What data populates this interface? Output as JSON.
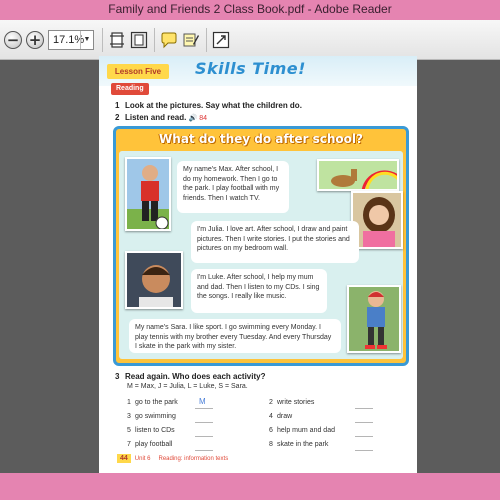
{
  "window": {
    "title": "Family and Friends 2 Class Book.pdf - Adobe Reader"
  },
  "toolbar": {
    "zoom_value": "17.1%",
    "zoom_out": "−",
    "zoom_in": "+",
    "dropdown_arrow": "▼"
  },
  "page": {
    "lesson": "Lesson Five",
    "heading": "Skills Time!",
    "section": "Reading",
    "instructions": [
      {
        "num": "1",
        "text": "Look at the pictures. Say what the children do."
      },
      {
        "num": "2",
        "text": "Listen and read.",
        "audio": "🔊 84"
      }
    ],
    "story": {
      "title": "What do they do after school?",
      "bubbles": [
        "My name's Max. After school, I do my homework. Then I go to the park. I play football with my friends. Then I watch TV.",
        "I'm Julia. I love art. After school, I draw and paint pictures. Then I write stories. I put the stories and pictures on my bedroom wall.",
        "I'm Luke. After school, I help my mum and dad. Then I listen to my CDs. I sing the songs. I really like music.",
        "My name's Sara. I like sport. I go swimming every Monday. I play tennis with my brother every Tuesday. And every Thursday I skate in the park with my sister."
      ]
    },
    "q3": {
      "num": "3",
      "text": "Read again. Who does each activity?",
      "key": "M = Max,  J = Julia,  L = Luke,  S = Sara."
    },
    "activities": [
      {
        "num": "1",
        "text": "go to the park",
        "answer": "M"
      },
      {
        "num": "2",
        "text": "write stories",
        "answer": ""
      },
      {
        "num": "3",
        "text": "go swimming",
        "answer": ""
      },
      {
        "num": "4",
        "text": "draw",
        "answer": ""
      },
      {
        "num": "5",
        "text": "listen to CDs",
        "answer": ""
      },
      {
        "num": "6",
        "text": "help mum and dad",
        "answer": ""
      },
      {
        "num": "7",
        "text": "play football",
        "answer": ""
      },
      {
        "num": "8",
        "text": "skate in the park",
        "answer": ""
      }
    ],
    "footer": {
      "page_number": "44",
      "unit": "Unit 6",
      "topic": "Reading: information texts"
    }
  }
}
